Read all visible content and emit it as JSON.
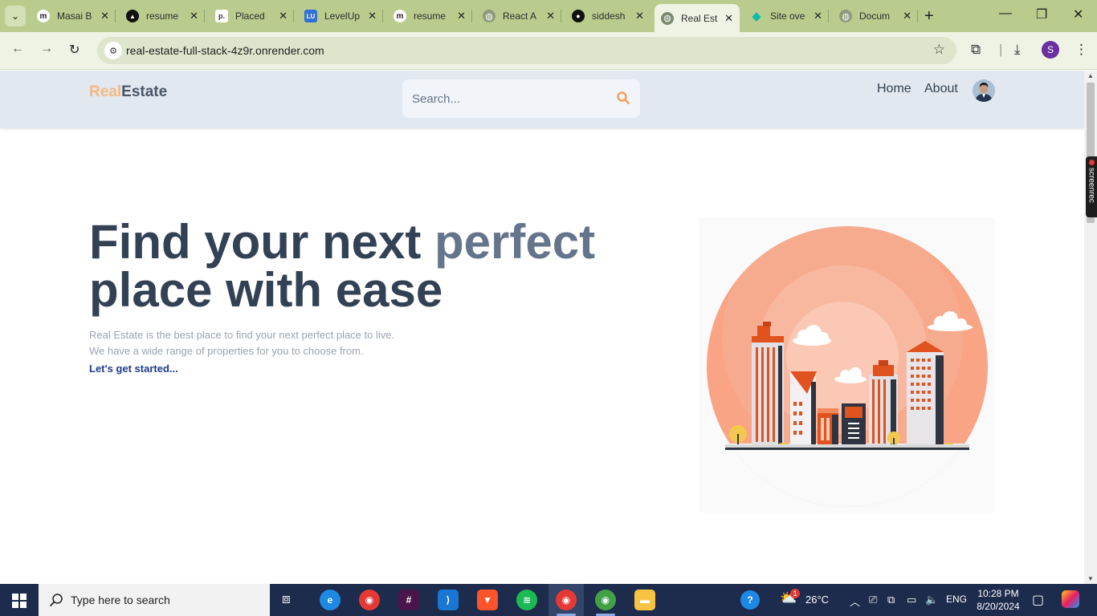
{
  "browser": {
    "tabs": [
      {
        "title": "Masai B",
        "favicon": "m",
        "fav_bg": "#ffffff",
        "fav_fg": "#222222"
      },
      {
        "title": "resume",
        "favicon": "▲",
        "fav_bg": "#111111",
        "fav_fg": "#ffffff"
      },
      {
        "title": "Placed",
        "favicon": "p.",
        "fav_bg": "#ffffff",
        "fav_fg": "#333333"
      },
      {
        "title": "LevelUp",
        "favicon": "LU",
        "fav_bg": "#2f6fd6",
        "fav_fg": "#ffffff"
      },
      {
        "title": "resume",
        "favicon": "m",
        "fav_bg": "#ffffff",
        "fav_fg": "#222222"
      },
      {
        "title": "React A",
        "favicon": "◍",
        "fav_bg": "#9aa58a",
        "fav_fg": "#ffffff"
      },
      {
        "title": "siddesh",
        "favicon": "●",
        "fav_bg": "#111111",
        "fav_fg": "#ffffff"
      },
      {
        "title": "Real Est",
        "favicon": "◍",
        "fav_bg": "#7d8a70",
        "fav_fg": "#ffffff"
      },
      {
        "title": "Site ove",
        "favicon": "◆",
        "fav_bg": "#b9cc8e",
        "fav_fg": "#14b8a6"
      },
      {
        "title": "Docum",
        "favicon": "◍",
        "fav_bg": "#9aa58a",
        "fav_fg": "#ffffff"
      }
    ],
    "active_tab_index": 7,
    "url": "real-estate-full-stack-4z9r.onrender.com",
    "profile_initial": "S"
  },
  "site": {
    "logo_part1": "Real",
    "logo_part2": "Estate",
    "search_placeholder": "Search...",
    "nav": {
      "home": "Home",
      "about": "About"
    },
    "hero": {
      "title_part1": "Find your next ",
      "title_highlight": "perfect",
      "title_part2": "place with ease",
      "description_line1": "Real Estate is the best place to find your next perfect place to live.",
      "description_line2": "We have a wide range of properties for you to choose from.",
      "cta": "Let's get started..."
    },
    "colors": {
      "logo_accent": "#f5b882",
      "logo_main": "#475569",
      "header_bg": "#e2e8f0",
      "cta": "#1e3a8a",
      "search_icon": "#f59e5b"
    }
  },
  "overlay": {
    "screenrec_label": "screenrec"
  },
  "taskbar": {
    "search_text": "Type here to search",
    "weather": "26°C",
    "language": "ENG",
    "time": "10:28 PM",
    "date": "8/20/2024",
    "weather_badge": "1"
  }
}
